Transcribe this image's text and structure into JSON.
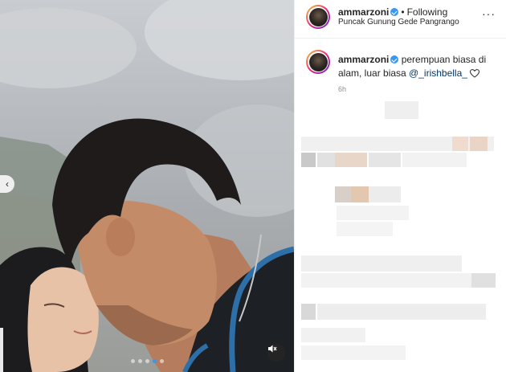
{
  "post": {
    "username": "ammarzoni",
    "separator": "•",
    "follow_status": "Following",
    "location": "Puncak Gunung Gede Pangrango",
    "more_icon": "···"
  },
  "comment": {
    "username": "ammarzoni",
    "text": "perempuan biasa di alam, luar biasa ",
    "mention": "@_irishbella_",
    "time": "6h"
  },
  "media": {
    "prev_icon": "chevron-left-icon",
    "mute_icon": "muted-speaker-icon",
    "slides_count": 5,
    "active_slide": 4
  },
  "colors": {
    "accent": "#3897f0",
    "text": "#262626",
    "muted": "#8e8e8e",
    "mention": "#00376b"
  }
}
